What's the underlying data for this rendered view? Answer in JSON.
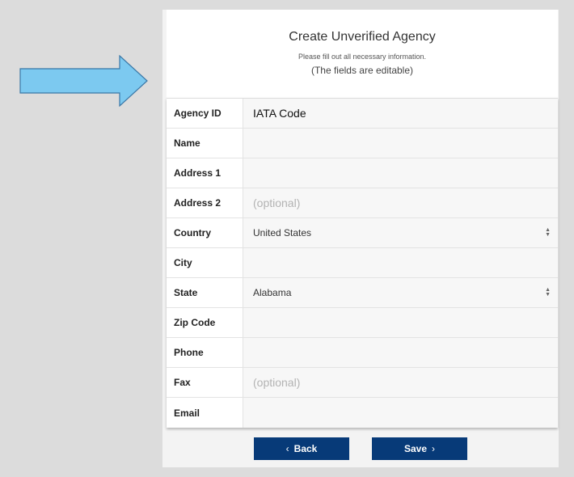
{
  "header": {
    "title": "Create Unverified Agency",
    "subtitle": "Please fill out all necessary information.",
    "note": "(The fields are editable)"
  },
  "fields": [
    {
      "label": "Agency ID",
      "value": "IATA Code",
      "placeholder": ""
    },
    {
      "label": "Name",
      "value": "",
      "placeholder": ""
    },
    {
      "label": "Address 1",
      "value": "",
      "placeholder": ""
    },
    {
      "label": "Address 2",
      "value": "",
      "placeholder": "(optional)"
    },
    {
      "label": "Country",
      "selected": "United States"
    },
    {
      "label": "City",
      "value": "",
      "placeholder": ""
    },
    {
      "label": "State",
      "selected": "Alabama"
    },
    {
      "label": "Zip Code",
      "value": "",
      "placeholder": ""
    },
    {
      "label": "Phone",
      "value": "",
      "placeholder": ""
    },
    {
      "label": "Fax",
      "value": "",
      "placeholder": "(optional)"
    },
    {
      "label": "Email",
      "value": "",
      "placeholder": ""
    }
  ],
  "buttons": {
    "back_label": "Back",
    "back_icon": "chevron-left-icon",
    "save_label": "Save",
    "save_icon": "chevron-right-icon"
  },
  "colors": {
    "button": "#073a78",
    "arrow_fill": "#7cc9f0",
    "arrow_stroke": "#3a77a6"
  }
}
